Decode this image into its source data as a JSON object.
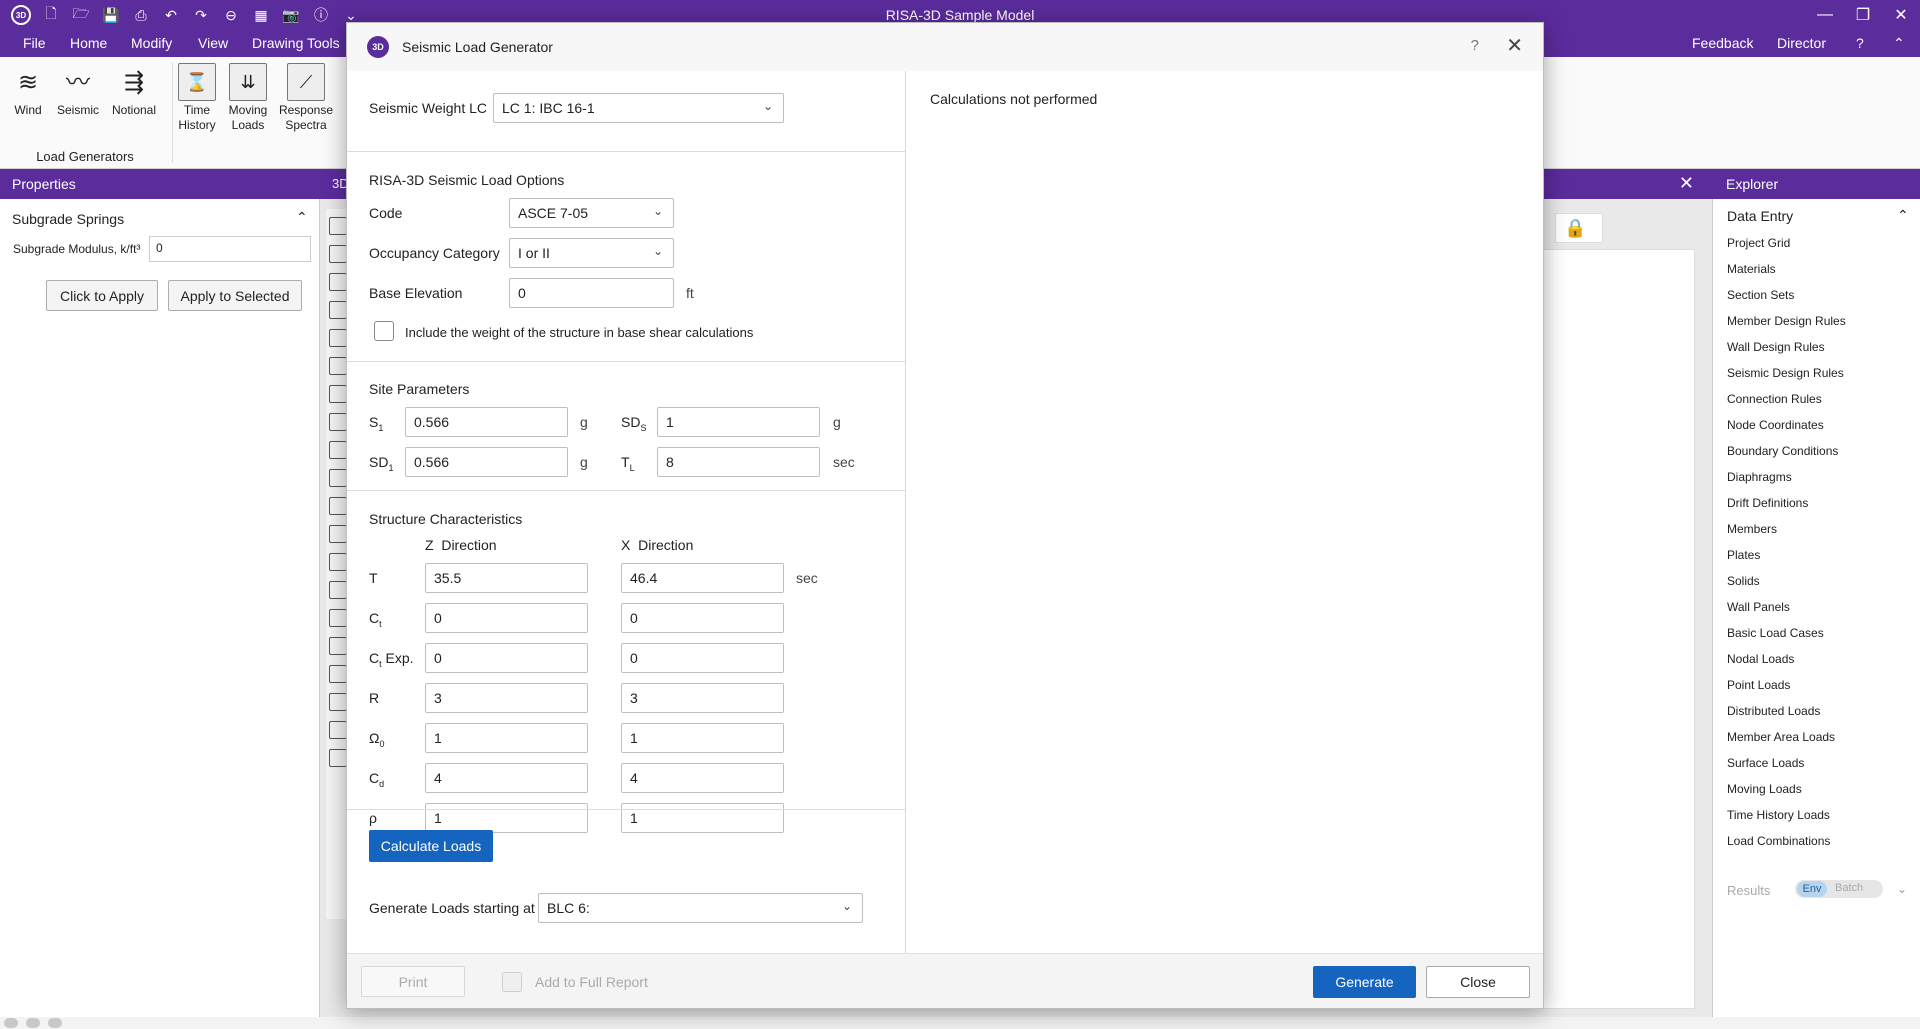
{
  "window": {
    "title": "RISA-3D Sample Model",
    "right_links": [
      "Feedback",
      "Director",
      "?"
    ]
  },
  "menu": [
    "File",
    "Home",
    "Modify",
    "View",
    "Drawing Tools"
  ],
  "ribbon": {
    "buttons": [
      {
        "label": "Wind",
        "icon": "wind-icon"
      },
      {
        "label": "Seismic",
        "icon": "seismic-icon"
      },
      {
        "label": "Notional",
        "icon": "notional-icon"
      },
      {
        "label": "Time\nHistory",
        "icon": "time-history-icon"
      },
      {
        "label": "Moving\nLoads",
        "icon": "moving-loads-icon"
      },
      {
        "label": "Response\nSpectra",
        "icon": "response-spectra-icon"
      }
    ],
    "group_label": "Load Generators"
  },
  "properties": {
    "header": "Properties",
    "section": "Subgrade Springs",
    "modulus_label": "Subgrade Modulus, k/ft³",
    "modulus_value": "0",
    "click_to_apply": "Click to Apply",
    "apply_to_selected": "Apply to Selected"
  },
  "middle": {
    "tab_label": "3D"
  },
  "explorer": {
    "header": "Explorer",
    "section": "Data Entry",
    "items": [
      "Project Grid",
      "Materials",
      "Section Sets",
      "Member Design Rules",
      "Wall Design Rules",
      "Seismic Design Rules",
      "Connection Rules",
      "Node Coordinates",
      "Boundary Conditions",
      "Diaphragms",
      "Drift Definitions",
      "Members",
      "Plates",
      "Solids",
      "Wall Panels",
      "Basic Load Cases",
      "Nodal Loads",
      "Point Loads",
      "Distributed Loads",
      "Member Area Loads",
      "Surface Loads",
      "Moving Loads",
      "Time History Loads",
      "Load Combinations"
    ],
    "results_label": "Results",
    "env_label": "Env",
    "batch_label": "Batch"
  },
  "dialog": {
    "title": "Seismic Load Generator",
    "seismic_weight_label": "Seismic Weight LC",
    "seismic_weight_value": "LC 1: IBC 16-1",
    "calc_status": "Calculations not performed",
    "options_title": "RISA-3D Seismic Load Options",
    "code_label": "Code",
    "code_value": "ASCE 7-05",
    "occupancy_label": "Occupancy Category",
    "occupancy_value": "I or II",
    "base_elev_label": "Base Elevation",
    "base_elev_value": "0",
    "base_elev_unit": "ft",
    "include_weight_label": "Include the weight of the structure in base shear calculations",
    "site_title": "Site Parameters",
    "s1_label": "S",
    "s1_sub": "1",
    "s1_value": "0.566",
    "s1_unit": "g",
    "sds_label": "SD",
    "sds_sub": "S",
    "sds_value": "1",
    "sds_unit": "g",
    "sd1_label": "SD",
    "sd1_sub": "1",
    "sd1_value": "0.566",
    "sd1_unit": "g",
    "tl_label": "T",
    "tl_sub": "L",
    "tl_value": "8",
    "tl_unit": "sec",
    "struct_title": "Structure Characteristics",
    "z_dir": "Z  Direction",
    "x_dir": "X  Direction",
    "rows": [
      {
        "label": "T",
        "sub": "",
        "suffix": "",
        "z": "35.5",
        "x": "46.4",
        "unit": "sec"
      },
      {
        "label": "C",
        "sub": "t",
        "suffix": "",
        "z": "0",
        "x": "0",
        "unit": ""
      },
      {
        "label": "C",
        "sub": "t",
        "suffix": " Exp.",
        "z": "0",
        "x": "0",
        "unit": ""
      },
      {
        "label": "R",
        "sub": "",
        "suffix": "",
        "z": "3",
        "x": "3",
        "unit": ""
      },
      {
        "label": "Ω",
        "sub": "0",
        "suffix": "",
        "z": "1",
        "x": "1",
        "unit": ""
      },
      {
        "label": "C",
        "sub": "d",
        "suffix": "",
        "z": "4",
        "x": "4",
        "unit": ""
      },
      {
        "label": "ρ",
        "sub": "",
        "suffix": "",
        "z": "1",
        "x": "1",
        "unit": ""
      }
    ],
    "calculate_label": "Calculate Loads",
    "gen_start_label": "Generate Loads starting at BLC",
    "gen_start_value": "BLC 6:",
    "print_label": "Print",
    "add_report_label": "Add to Full Report",
    "generate_label": "Generate",
    "close_label": "Close"
  },
  "colors": {
    "brand": "#5b2c9c",
    "primary_button": "#1565c0"
  }
}
